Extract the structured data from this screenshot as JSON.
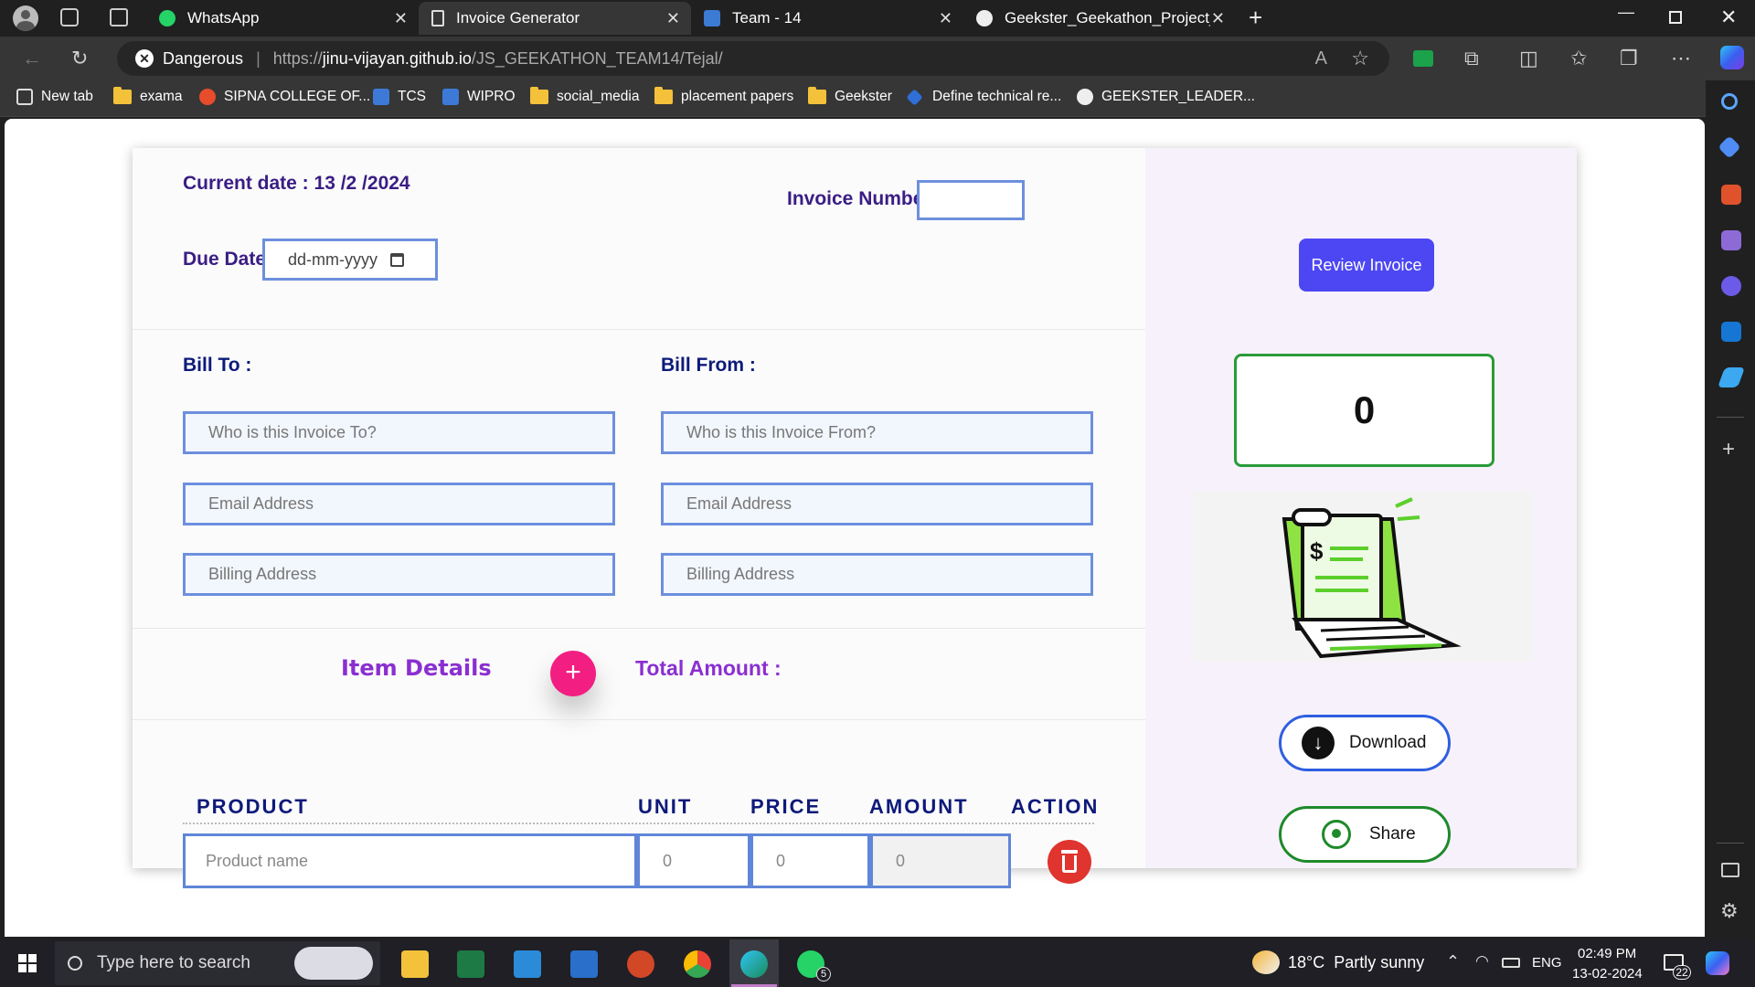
{
  "browser": {
    "tabs": [
      {
        "title": "WhatsApp",
        "close": "✕"
      },
      {
        "title": "Invoice Generator",
        "close": "✕"
      },
      {
        "title": "Team - 14",
        "close": "✕"
      },
      {
        "title": "Geekster_Geekathon_Project_Mc",
        "close": "✕"
      }
    ],
    "new_tab": "+",
    "security_label": "Dangerous",
    "url_prefix": "https://",
    "url_domain": "jinu-vijayan.github.io",
    "url_path": "/JS_GEEKATHON_TEAM14/Tejal/",
    "read_aloud": "A",
    "bookmarks": [
      "New tab",
      "exama",
      "SIPNA COLLEGE OF...",
      "TCS",
      "WIPRO",
      "social_media",
      "placement papers",
      "Geekster",
      "Define technical re...",
      "GEEKSTER_LEADER..."
    ]
  },
  "invoice": {
    "current_date_label": "Current date : 13 /2 /2024",
    "invoice_number_label": "Invoice Number",
    "invoice_number_value": "",
    "due_date_label": "Due Date",
    "due_date_placeholder": "dd-mm-yyyy",
    "bill_to_label": "Bill To :",
    "bill_from_label": "Bill From :",
    "bill_to_name_placeholder": "Who is this Invoice To?",
    "bill_from_name_placeholder": "Who is this Invoice From?",
    "email_placeholder": "Email Address",
    "billing_address_placeholder": "Billing Address",
    "item_details_label": "Item Details",
    "add_button": "+",
    "total_amount_label": "Total Amount :",
    "columns": [
      "PRODUCT",
      "UNIT",
      "PRICE",
      "AMOUNT",
      "ACTION"
    ],
    "row": {
      "product_placeholder": "Product name",
      "unit": "0",
      "price": "0",
      "amount": "0"
    }
  },
  "sidebar": {
    "review_button": "Review Invoice",
    "total_display": "0",
    "download_button": "Download",
    "share_button": "Share"
  },
  "taskbar": {
    "search_placeholder": "Type here to search",
    "weather": "18°C  Partly sunny",
    "lang": "ENG",
    "time": "02:49 PM",
    "date": "13-02-2024",
    "notifications": "22",
    "whatsapp_badge": "5"
  },
  "colors": {
    "accent": "#4d47f3",
    "heading": "#3a1d84",
    "add_button": "#f31e82",
    "delete_button": "#e0342f",
    "share_border": "#1e8a2a"
  }
}
